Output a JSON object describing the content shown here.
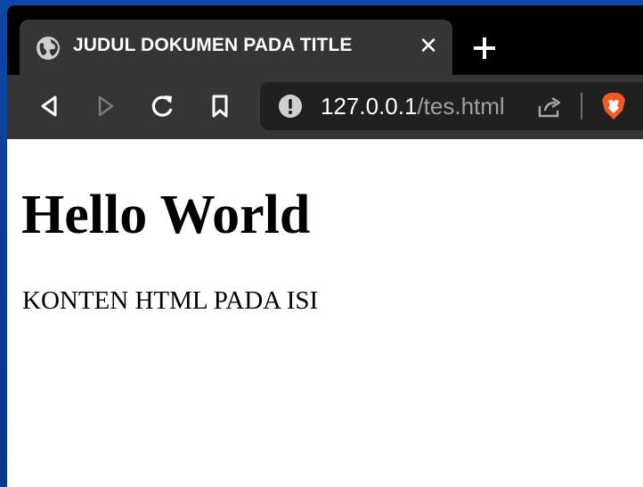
{
  "tab": {
    "title": "JUDUL DOKUMEN PADA TITLE",
    "close_glyph": "✕",
    "favicon": "globe-icon"
  },
  "toolbar": {
    "buttons": [
      "back-icon",
      "forward-icon",
      "reload-icon",
      "bookmark-icon"
    ],
    "url_host": "127.0.0.1",
    "url_path": "/tes.html",
    "icons": [
      "info-icon",
      "share-icon",
      "brave-shield-icon"
    ]
  },
  "page": {
    "heading": "Hello World",
    "paragraph": "KONTEN HTML PADA ISI"
  },
  "colors": {
    "desktop": "#0a3b93",
    "tabstrip": "#000000",
    "toolbar": "#353535",
    "omnibox": "#202020",
    "brave": "#f25a23"
  }
}
